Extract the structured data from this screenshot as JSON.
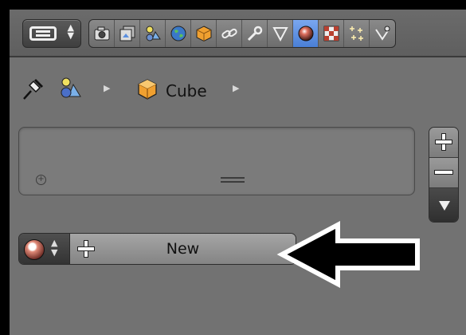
{
  "editor_menu": {
    "icon": "editor-type-icon"
  },
  "tabs": [
    {
      "name": "render-icon",
      "active": false
    },
    {
      "name": "render-layers-icon",
      "active": false
    },
    {
      "name": "scene-icon",
      "active": false
    },
    {
      "name": "world-icon",
      "active": false
    },
    {
      "name": "object-icon",
      "active": false
    },
    {
      "name": "constraints-icon",
      "active": false
    },
    {
      "name": "modifiers-icon",
      "active": false
    },
    {
      "name": "data-icon",
      "active": false
    },
    {
      "name": "material-icon",
      "active": true
    },
    {
      "name": "texture-icon",
      "active": false
    },
    {
      "name": "particles-icon",
      "active": false
    },
    {
      "name": "physics-icon",
      "active": false
    }
  ],
  "breadcrumb": {
    "object_name": "Cube"
  },
  "material": {
    "new_label": "New"
  },
  "colors": {
    "panel_bg": "#727272",
    "active_tab": "#5a8fe0",
    "cube_orange": "#f0a030"
  }
}
